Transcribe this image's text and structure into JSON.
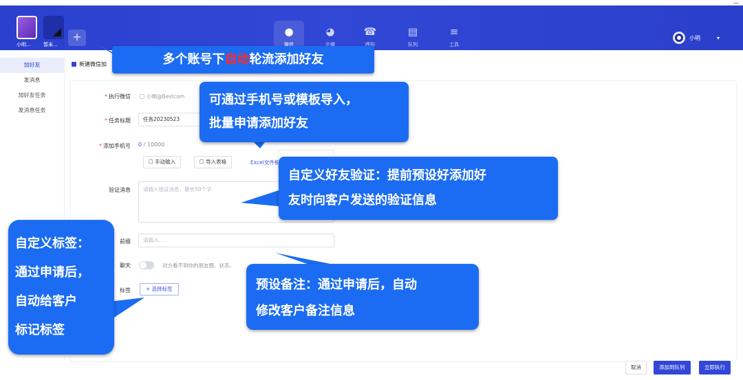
{
  "window": {
    "corner_icon": "—"
  },
  "accounts": [
    {
      "name": "小明..."
    },
    {
      "name": "暂未..."
    }
  ],
  "nav": [
    {
      "label": "微信",
      "icon": "wechat-icon",
      "glyph": "●",
      "active": true
    },
    {
      "label": "企微",
      "icon": "wecom-icon",
      "glyph": "◕"
    },
    {
      "label": "呼叫",
      "icon": "phone-icon",
      "glyph": "☎"
    },
    {
      "label": "队列",
      "icon": "queue-icon",
      "glyph": "▤"
    },
    {
      "label": "工具",
      "icon": "layers-icon",
      "glyph": "≡"
    }
  ],
  "user": {
    "name": "小明"
  },
  "sidebar": {
    "items": [
      {
        "label": "加好友",
        "active": true
      },
      {
        "label": "发消息"
      },
      {
        "label": "加好友任务"
      },
      {
        "label": "发消息任务"
      }
    ]
  },
  "page": {
    "title": "新建微信加"
  },
  "form": {
    "exec_wechat": {
      "label": "执行微信",
      "value": "小明@Bestcom"
    },
    "task_title": {
      "label": "任务标题",
      "value": "任务20230523"
    },
    "phone": {
      "label": "添加手机号",
      "count": "0",
      "max": "/ 10000",
      "manual_btn": "手动输入",
      "import_btn": "导入表格",
      "excel_link": "Excel文件模"
    },
    "verify": {
      "label": "验证消息",
      "placeholder": "请输入验证消息，最长50个字"
    },
    "remark": {
      "label": "前缀",
      "placeholder": "请输入..."
    },
    "chat": {
      "label": "聊天",
      "hint": "对方看不到你的朋友圈、状态、"
    },
    "tags": {
      "label": "标签",
      "button": "+ 选择标签"
    }
  },
  "footer": {
    "cancel": "取消",
    "add_queue": "添加到队列",
    "run_now": "立即执行"
  },
  "callouts": {
    "c1": {
      "before": "多个账号下",
      "highlight": "自动",
      "after": "轮流添加好友"
    },
    "c2": [
      "可通过手机号或模板导入，",
      "批量申请添加好友"
    ],
    "c3": [
      "自定义好友验证：提前预设好添加好",
      "友时向客户发送的验证信息"
    ],
    "c4": [
      "自定义标签：",
      "通过申请后，",
      "自动给客户",
      "标记标签"
    ],
    "c5": [
      "预设备注：通过申请后，自动",
      "修改客户备注信息"
    ]
  },
  "colors": {
    "topbar": "#3147d6",
    "accent": "#2f46d4",
    "callout": "#1b6cf2",
    "highlight": "#ff2b2b"
  }
}
